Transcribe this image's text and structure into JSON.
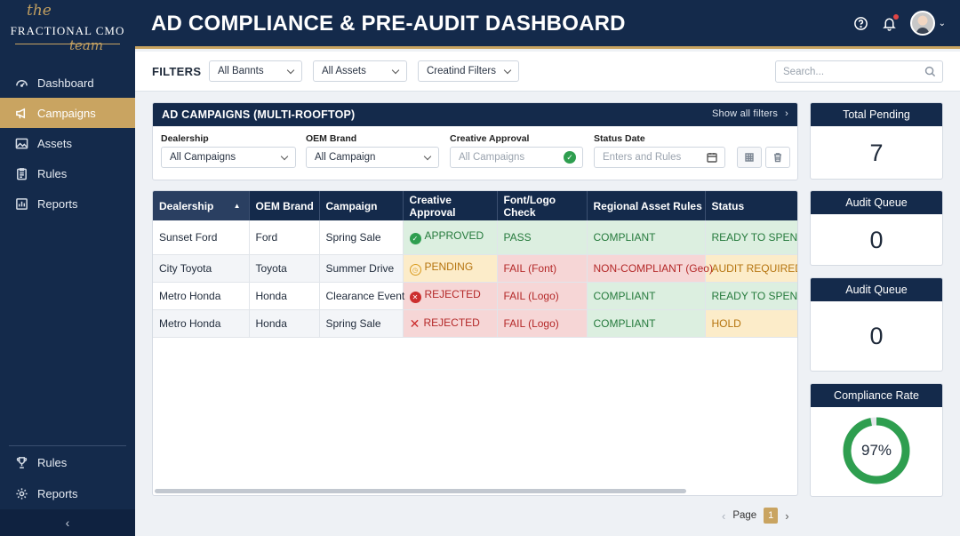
{
  "brand": {
    "script_top": "the",
    "name": "FRACTIONAL CMO",
    "script_bottom": "team"
  },
  "sidebar": {
    "items": [
      {
        "label": "Dashboard",
        "icon": "dashboard-gauge-icon"
      },
      {
        "label": "Campaigns",
        "icon": "megaphone-icon",
        "active": true
      },
      {
        "label": "Assets",
        "icon": "image-icon"
      },
      {
        "label": "Rules",
        "icon": "clipboard-icon"
      },
      {
        "label": "Reports",
        "icon": "bar-chart-icon"
      }
    ],
    "bottom_items": [
      {
        "label": "Rules",
        "icon": "trophy-icon"
      },
      {
        "label": "Reports",
        "icon": "gear-icon"
      }
    ],
    "collapse_glyph": "‹"
  },
  "header": {
    "title": "AD COMPLIANCE & PRE-AUDIT DASHBOARD"
  },
  "filters": {
    "label": "FILTERS",
    "dropdowns": [
      "All Baпnts",
      "All Assets",
      "Creatind Filters"
    ],
    "search_placeholder": "Search..."
  },
  "campaigns_panel": {
    "title": "AD CAMPAIGNS (MULTI-ROOFTOP)",
    "show_all": "Show all filters",
    "fields": [
      {
        "label": "Dealership",
        "value": "All Campaigns"
      },
      {
        "label": "OEM Brand",
        "value": "All Campaign"
      },
      {
        "label": "Creative Approval",
        "value": "All Campaigns"
      },
      {
        "label": "Status Date",
        "value": "Enters and Rules"
      }
    ]
  },
  "table": {
    "columns": [
      "Dealership",
      "OEM Brand",
      "Campaign",
      "Creative Approval",
      "Font/Logo Check",
      "Regional Asset Rules",
      "Status"
    ],
    "rows": [
      [
        "Sunset Ford",
        "Ford",
        "Spring Sale",
        "APPROVED",
        "PASS",
        "COMPLIANT",
        "READY TO SPEND"
      ],
      [
        "City Toyota",
        "Toyota",
        "Summer Drive",
        "PENDING",
        "FAIL (Font)",
        "NON-COMPLIANT (Geo)",
        "AUDIT REQUIRED"
      ],
      [
        "Metro Honda",
        "Honda",
        "Clearance Event",
        "REJECTED",
        "FAIL (Logo)",
        "COMPLIANT",
        "READY TO SPEND"
      ],
      [
        "Metro Honda",
        "Honda",
        "Spring Sale",
        "REJECTED",
        "FAIL (Logo)",
        "COMPLIANT",
        "HOLD"
      ]
    ]
  },
  "pager": {
    "label": "Page",
    "current": "1",
    "prev": "‹",
    "next": "›"
  },
  "kpis": [
    {
      "title": "Total Pending",
      "value": "7"
    },
    {
      "title": "Audit Queue",
      "value": "0"
    },
    {
      "title": "Audit Queue",
      "value": "0"
    }
  ],
  "compliance": {
    "title": "Compliance Rate",
    "value_label": "97%",
    "fraction": 0.97,
    "color": "#2e9e4f"
  },
  "colors": {
    "navy": "#142a4b",
    "gold": "#c9a461",
    "pass_green": "#2e9e4f",
    "fail_red": "#cc2e2e",
    "warn_amber": "#d99a1c"
  }
}
